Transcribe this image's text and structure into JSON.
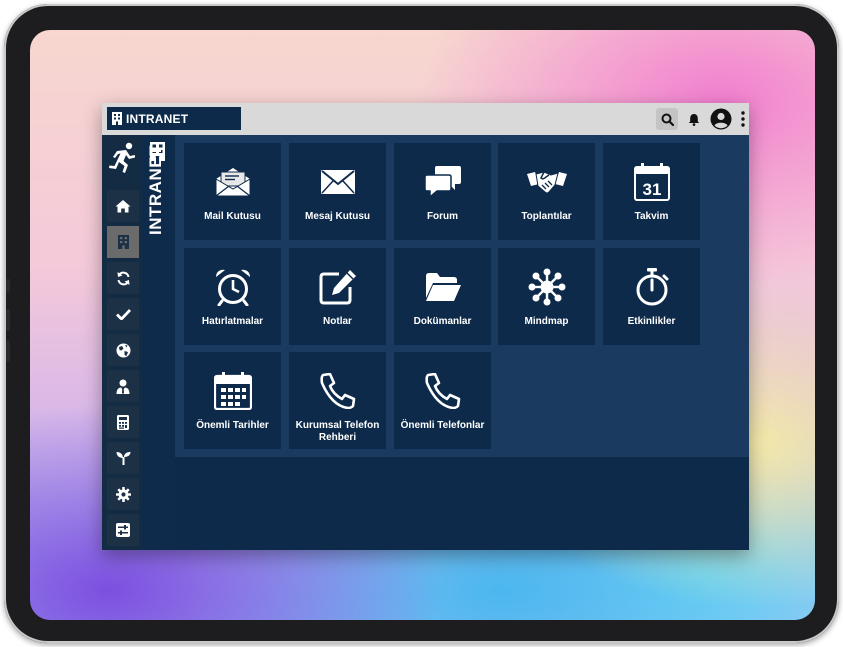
{
  "app": {
    "brand_title": "INTRANET",
    "vertical_title": "INTRANET"
  },
  "topbar": {
    "icons": [
      "search-icon",
      "bell-icon",
      "user-circle-icon",
      "more-vertical-icon"
    ]
  },
  "sidebar": {
    "items": [
      {
        "icon": "home-icon"
      },
      {
        "icon": "building-icon",
        "active": true
      },
      {
        "icon": "refresh-icon"
      },
      {
        "icon": "check-icon"
      },
      {
        "icon": "globe-icon"
      },
      {
        "icon": "user-tie-icon"
      },
      {
        "icon": "calculator-icon"
      },
      {
        "icon": "seedling-icon"
      },
      {
        "icon": "gear-icon"
      },
      {
        "icon": "sliders-icon"
      }
    ]
  },
  "tiles": [
    {
      "label": "Mail Kutusu",
      "icon": "open-envelope-icon"
    },
    {
      "label": "Mesaj Kutusu",
      "icon": "envelope-icon"
    },
    {
      "label": "Forum",
      "icon": "comments-icon"
    },
    {
      "label": "Toplantılar",
      "icon": "handshake-icon"
    },
    {
      "label": "Takvim",
      "icon": "calendar-31-icon"
    },
    {
      "label": "Hatırlatmalar",
      "icon": "alarm-clock-icon"
    },
    {
      "label": "Notlar",
      "icon": "edit-icon"
    },
    {
      "label": "Dokümanlar",
      "icon": "folder-open-icon"
    },
    {
      "label": "Mindmap",
      "icon": "network-icon"
    },
    {
      "label": "Etkinlikler",
      "icon": "stopwatch-icon"
    },
    {
      "label": "Önemli Tarihler",
      "icon": "calendar-grid-icon"
    },
    {
      "label": "Kurumsal Telefon Rehberi",
      "icon": "phone-icon"
    },
    {
      "label": "Önemli Telefonlar",
      "icon": "phone-icon"
    }
  ]
}
